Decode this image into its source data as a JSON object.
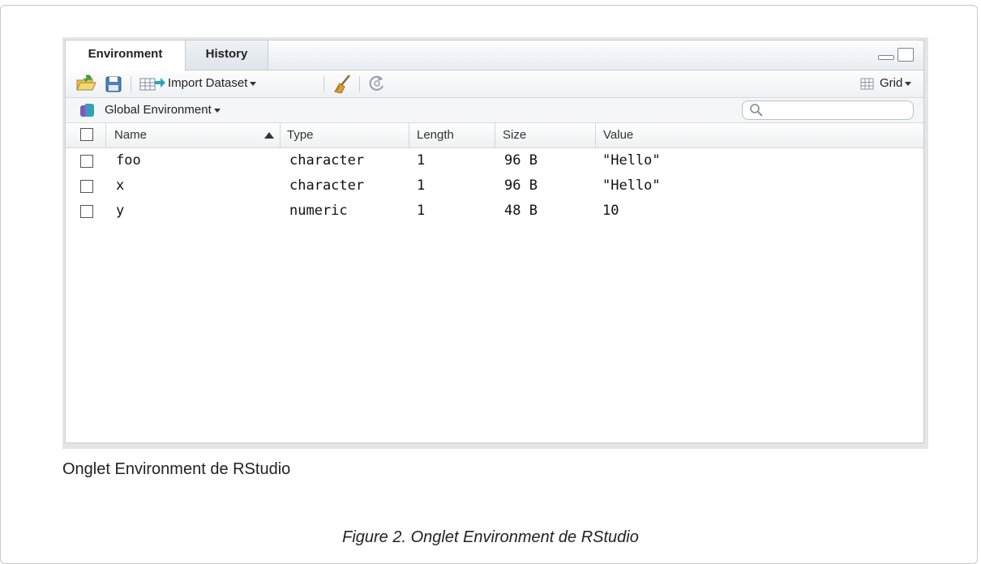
{
  "tabs": [
    {
      "label": "Environment",
      "active": true
    },
    {
      "label": "History",
      "active": false
    }
  ],
  "toolbar": {
    "import_dataset_label": "Import Dataset",
    "view_label": "Grid"
  },
  "environment": {
    "selector_label": "Global Environment",
    "search_placeholder": ""
  },
  "table": {
    "columns": [
      "Name",
      "Type",
      "Length",
      "Size",
      "Value"
    ],
    "sort_column": "Name",
    "rows": [
      {
        "name": "foo",
        "type": "character",
        "length": "1",
        "size": "96 B",
        "value": "\"Hello\""
      },
      {
        "name": "x",
        "type": "character",
        "length": "1",
        "size": "96 B",
        "value": "\"Hello\""
      },
      {
        "name": "y",
        "type": "numeric",
        "length": "1",
        "size": "48 B",
        "value": "10"
      }
    ]
  },
  "captions": {
    "image_label": "Onglet Environment de RStudio",
    "figure": "Figure 2. Onglet Environment de RStudio"
  },
  "colors": {
    "accent_brush": "#d9a13a",
    "env_icon_purple": "#7a5bb5",
    "env_icon_teal": "#2aa6b5",
    "open_icon_green": "#3f9b3f"
  },
  "icons": [
    "open-workspace-icon",
    "save-workspace-icon",
    "import-dataset-icon",
    "clear-workspace-icon",
    "refresh-icon",
    "grid-view-icon",
    "environment-icon",
    "search-icon",
    "minimize-icon",
    "maximize-icon",
    "sort-ascending-icon"
  ]
}
